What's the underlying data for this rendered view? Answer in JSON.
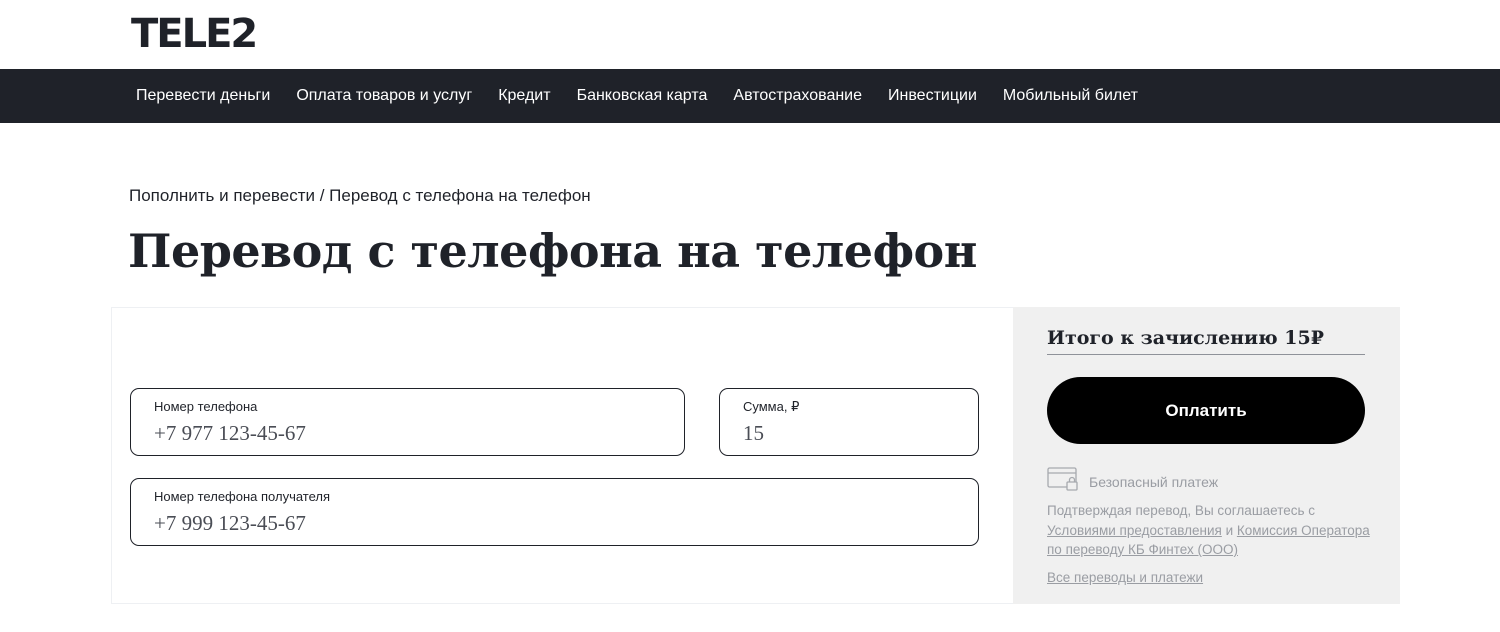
{
  "brand": {
    "logo_text": "TELE",
    "logo_number": "2"
  },
  "nav": {
    "items": [
      "Перевести деньги",
      "Оплата товаров и услуг",
      "Кредит",
      "Банковская карта",
      "Автострахование",
      "Инвестиции",
      "Мобильный билет"
    ]
  },
  "breadcrumb": {
    "parent": "Пополнить и перевести",
    "separator": " / ",
    "current": "Перевод с телефона на телефон"
  },
  "page": {
    "title": "Перевод с телефона на телефон"
  },
  "form": {
    "phone": {
      "label": "Номер телефона",
      "value": "+7 977 123-45-67"
    },
    "amount": {
      "label": "Сумма, ₽",
      "value": "15"
    },
    "recipient": {
      "label": "Номер телефона получателя",
      "value": "+7 999 123-45-67"
    }
  },
  "summary": {
    "total_label": "Итого к зачислению 15₽",
    "pay_button": "Оплатить",
    "secure_text": "Безопасный платеж",
    "terms_prefix": "Подтверждая перевод, Вы соглашаетесь с ",
    "terms_link1": "Условиями предоставления",
    "terms_and": " и ",
    "terms_link2": "Комиссия Оператора по переводу КБ Финтех (ООО)",
    "all_payments_link": "Все переводы и платежи"
  },
  "colors": {
    "dark": "#1f2229",
    "summary_bg": "#f0f0f0",
    "muted_text": "#9a9da3",
    "button_bg": "#000000"
  }
}
